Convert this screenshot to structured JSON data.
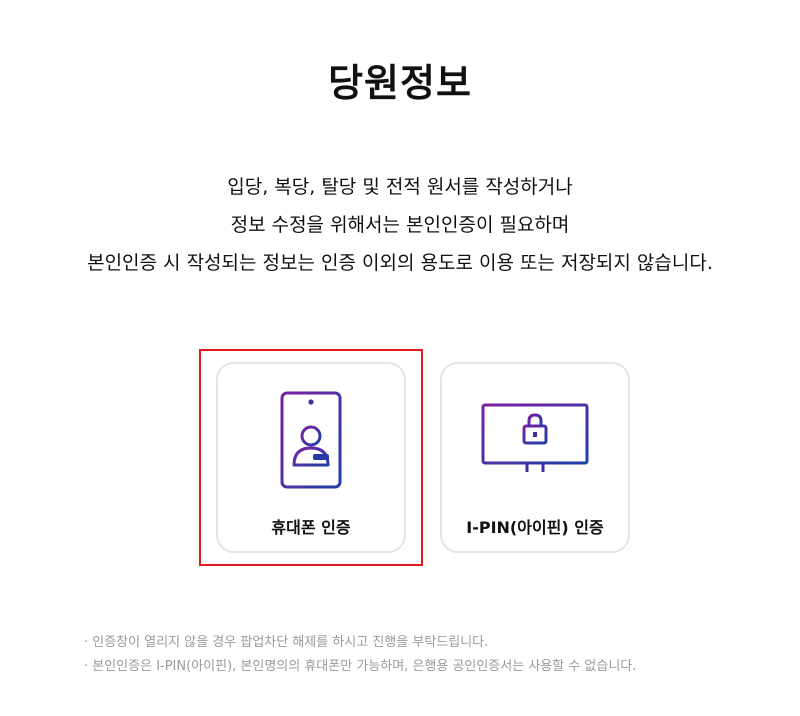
{
  "page": {
    "title": "당원정보"
  },
  "description": [
    "입당, 복당, 탈당 및 전적 원서를 작성하거나",
    "정보 수정을 위해서는 본인인증이 필요하며",
    "본인인증 시 작성되는 정보는 인증 이외의 용도로 이용 또는 저장되지 않습니다."
  ],
  "auth_options": [
    {
      "label": "휴대폰 인증",
      "icon": "mobile-phone-user-icon"
    },
    {
      "label": "I-PIN(아이핀) 인증",
      "icon": "monitor-lock-icon"
    }
  ],
  "notes": [
    "· 인증창이 열리지 않을 경우 팝업차단 해제를 하시고 진행을 부탁드립니다.",
    "· 본인인증은 I-PIN(아이핀), 본인명의의 휴대폰만 가능하며, 은행용 공인인증서는 사용할 수 없습니다."
  ],
  "colors": {
    "highlight_border": "#e5161c",
    "icon_gradient_start": "#7b1fa2",
    "icon_gradient_end": "#1e3fa8"
  }
}
